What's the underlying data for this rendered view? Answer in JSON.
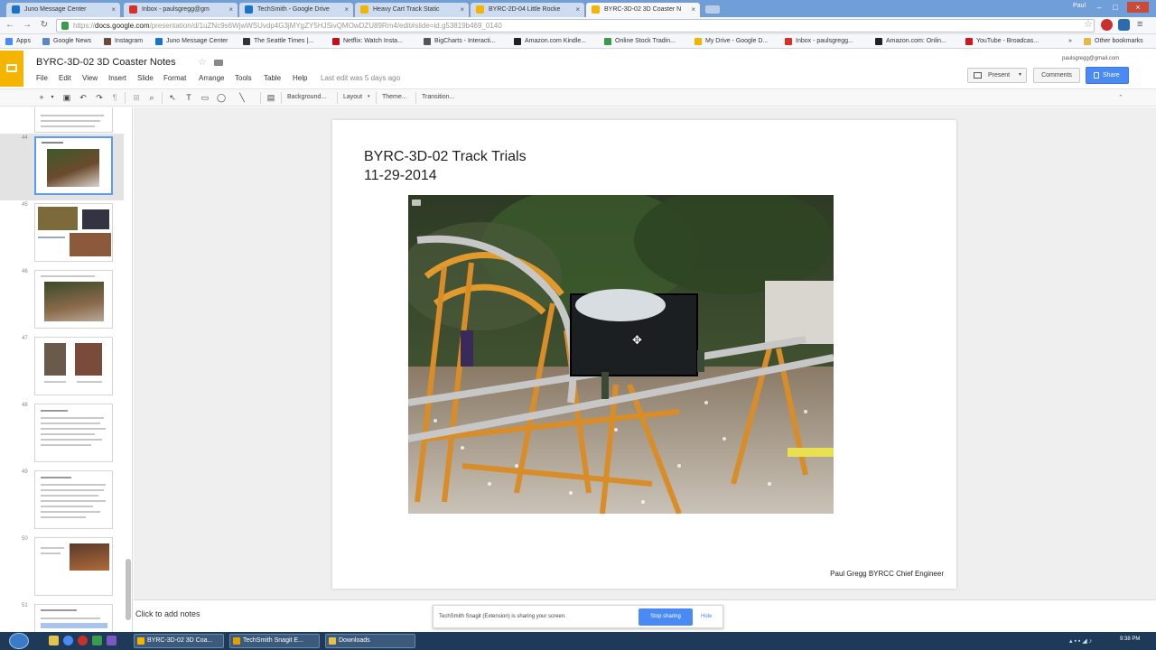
{
  "browser": {
    "tabs": [
      {
        "label": "Juno Message Center",
        "favicon_color": "#1a73c8"
      },
      {
        "label": "Inbox - paulsgregg@gm",
        "favicon_color": "#d93025"
      },
      {
        "label": "TechSmith - Google Drive",
        "favicon_color": "#1a73c8"
      },
      {
        "label": "Heavy Cart Track Static",
        "favicon_color": "#f4b400"
      },
      {
        "label": "BYRC-2D-04 Little Rocke",
        "favicon_color": "#f4b400"
      },
      {
        "label": "BYRC-3D-02 3D Coaster N",
        "favicon_color": "#f4b400"
      }
    ],
    "user": "Paul",
    "url_scheme": "https://",
    "url_host": "docs.google.com",
    "url_path": "/presentation/d/1uZNc9s6WjwWSUvdp4G3jMYgZY5HJSivQMOwDZU89Rm4/edit#slide=id.g53819b469_0140"
  },
  "bookmarks": [
    {
      "label": "Apps",
      "color": "#4a8af4"
    },
    {
      "label": "Google News",
      "color": "#5b85c9"
    },
    {
      "label": "Instagram",
      "color": "#6b4a3a"
    },
    {
      "label": "Juno Message Center",
      "color": "#1a73c8"
    },
    {
      "label": "The Seattle Times |...",
      "color": "#333333"
    },
    {
      "label": "Netflix: Watch Insta...",
      "color": "#c0121c"
    },
    {
      "label": "BigCharts - Interacti...",
      "color": "#555555"
    },
    {
      "label": "Amazon.com Kindle...",
      "color": "#222222"
    },
    {
      "label": "Online Stock Tradin...",
      "color": "#3a9c4a"
    },
    {
      "label": "My Drive - Google D...",
      "color": "#f4b400"
    },
    {
      "label": "Inbox - paulsgregg...",
      "color": "#d93025"
    },
    {
      "label": "Amazon.com: Onlin...",
      "color": "#222222"
    },
    {
      "label": "YouTube - Broadcas...",
      "color": "#cc181e"
    },
    {
      "label": "Other bookmarks",
      "color": "#e6b84a"
    }
  ],
  "document": {
    "title": "BYRC-3D-02 3D Coaster Notes",
    "account": "paulsgregg@gmail.com",
    "menu": [
      "File",
      "Edit",
      "View",
      "Insert",
      "Slide",
      "Format",
      "Arrange",
      "Tools",
      "Table",
      "Help"
    ],
    "last_edit": "Last edit was 5 days ago",
    "present_label": "Present",
    "comments_label": "Comments",
    "share_label": "Share"
  },
  "toolbar": {
    "background_label": "Background...",
    "layout_label": "Layout",
    "theme_label": "Theme...",
    "transition_label": "Transition..."
  },
  "filmstrip": {
    "slides": [
      {
        "number": "",
        "kind": "text"
      },
      {
        "number": "44",
        "kind": "photo",
        "selected": true
      },
      {
        "number": "45",
        "kind": "photos"
      },
      {
        "number": "46",
        "kind": "photo"
      },
      {
        "number": "47",
        "kind": "two-photos"
      },
      {
        "number": "48",
        "kind": "text"
      },
      {
        "number": "49",
        "kind": "text"
      },
      {
        "number": "50",
        "kind": "photo-right"
      },
      {
        "number": "51",
        "kind": "text"
      }
    ]
  },
  "slide": {
    "title": "BYRC-3D-02 Track Trials\n11-29-2014",
    "credit": "Paul Gregg  BYRCC Chief Engineer"
  },
  "notes": {
    "placeholder": "Click to add notes"
  },
  "sharebar": {
    "message": "TechSmith Snagit (Extension) is sharing your screen.",
    "stop_label": "Stop sharing",
    "hide_label": "Hide"
  },
  "taskbar": {
    "tasks": [
      {
        "label": "BYRC-3D-02 3D Coa...",
        "color": "#f4b400"
      },
      {
        "label": "TechSmith Snagit E...",
        "color": "#e0a000"
      },
      {
        "label": "Downloads",
        "color": "#e6c24a"
      }
    ],
    "clock": "9:38 PM"
  }
}
